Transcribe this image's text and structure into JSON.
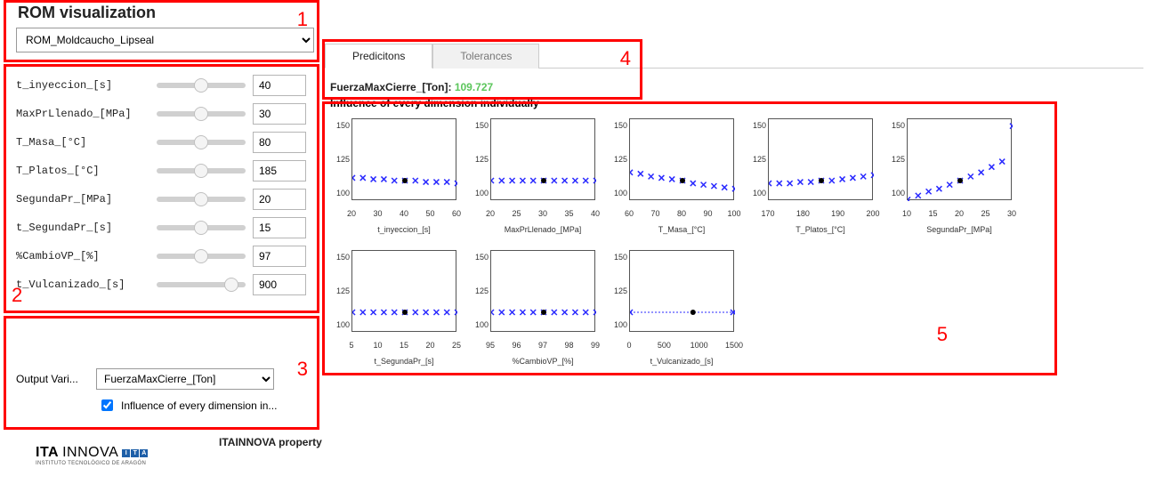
{
  "header": {
    "title": "ROM visualization",
    "rom_selected": "ROM_Moldcaucho_Lipseal"
  },
  "sliders": [
    {
      "label": "t_inyeccion_[s]",
      "value": "40",
      "thumb_pct": 50
    },
    {
      "label": "MaxPrLlenado_[MPa]",
      "value": "30",
      "thumb_pct": 50
    },
    {
      "label": "T_Masa_[°C]",
      "value": "80",
      "thumb_pct": 50
    },
    {
      "label": "T_Platos_[°C]",
      "value": "185",
      "thumb_pct": 50
    },
    {
      "label": "SegundaPr_[MPa]",
      "value": "20",
      "thumb_pct": 50
    },
    {
      "label": "t_SegundaPr_[s]",
      "value": "15",
      "thumb_pct": 50
    },
    {
      "label": "%CambioVP_[%]",
      "value": "97",
      "thumb_pct": 50
    },
    {
      "label": "t_Vulcanizado_[s]",
      "value": "900",
      "thumb_pct": 84
    }
  ],
  "output": {
    "label": "Output Vari...",
    "selected": "FuerzaMaxCierre_[Ton]",
    "checkbox_label": "Influence of every dimension in...",
    "checkbox_checked": true
  },
  "tabs": {
    "active": "Predicitons",
    "inactive": "Tolerances"
  },
  "prediction": {
    "name": "FuerzaMaxCierre_[Ton]:",
    "value": "109.727"
  },
  "charts_title": "Influence of every dimension individually",
  "yticks": [
    "150",
    "125",
    "100"
  ],
  "annotations": {
    "n1": "1",
    "n2": "2",
    "n3": "3",
    "n4": "4",
    "n5": "5"
  },
  "footer": {
    "property": "ITAINNOVA property",
    "brand_bold": "ITA",
    "brand_light": "INNOVA",
    "brand_sub": "INSTITUTO TECNOLÓGICO DE ARAGÓN"
  },
  "chart_data": [
    {
      "type": "scatter",
      "xlabel": "t_inyeccion_[s]",
      "ylabel": "",
      "ylim": [
        95,
        155
      ],
      "x_ticks": [
        20,
        30,
        40,
        50,
        60
      ],
      "marker_x": 40,
      "x": [
        20,
        24,
        28,
        32,
        36,
        40,
        44,
        48,
        52,
        56,
        60
      ],
      "y": [
        112,
        112,
        111,
        111,
        110,
        110,
        110,
        109,
        109,
        109,
        108
      ]
    },
    {
      "type": "scatter",
      "xlabel": "MaxPrLlenado_[MPa]",
      "ylabel": "",
      "ylim": [
        95,
        155
      ],
      "x_ticks": [
        20,
        25,
        30,
        35,
        40
      ],
      "marker_x": 30,
      "x": [
        20,
        22,
        24,
        26,
        28,
        30,
        32,
        34,
        36,
        38,
        40
      ],
      "y": [
        110,
        110,
        110,
        110,
        110,
        110,
        110,
        110,
        110,
        110,
        110
      ]
    },
    {
      "type": "scatter",
      "xlabel": "T_Masa_[°C]",
      "ylabel": "",
      "ylim": [
        95,
        155
      ],
      "x_ticks": [
        60,
        70,
        80,
        90,
        100
      ],
      "marker_x": 80,
      "x": [
        60,
        64,
        68,
        72,
        76,
        80,
        84,
        88,
        92,
        96,
        100
      ],
      "y": [
        116,
        115,
        113,
        112,
        111,
        110,
        108,
        107,
        106,
        105,
        104
      ]
    },
    {
      "type": "scatter",
      "xlabel": "T_Platos_[°C]",
      "ylabel": "",
      "ylim": [
        95,
        155
      ],
      "x_ticks": [
        170,
        180,
        190,
        200
      ],
      "marker_x": 185,
      "x": [
        170,
        173,
        176,
        179,
        182,
        185,
        188,
        191,
        194,
        197,
        200
      ],
      "y": [
        108,
        108,
        108,
        109,
        109,
        110,
        110,
        111,
        112,
        113,
        114
      ]
    },
    {
      "type": "scatter",
      "xlabel": "SegundaPr_[MPa]",
      "ylabel": "",
      "ylim": [
        95,
        155
      ],
      "x_ticks": [
        10,
        15,
        20,
        25,
        30
      ],
      "marker_x": 20,
      "x": [
        10,
        12,
        14,
        16,
        18,
        20,
        22,
        24,
        26,
        28,
        30
      ],
      "y": [
        96,
        99,
        102,
        104,
        107,
        110,
        113,
        116,
        120,
        124,
        150
      ]
    },
    {
      "type": "scatter",
      "xlabel": "t_SegundaPr_[s]",
      "ylabel": "",
      "ylim": [
        95,
        155
      ],
      "x_ticks": [
        5,
        10,
        15,
        20,
        25
      ],
      "marker_x": 15,
      "x": [
        5,
        7,
        9,
        11,
        13,
        15,
        17,
        19,
        21,
        23,
        25
      ],
      "y": [
        110,
        110,
        110,
        110,
        110,
        110,
        110,
        110,
        110,
        110,
        110
      ]
    },
    {
      "type": "scatter",
      "xlabel": "%CambioVP_[%]",
      "ylabel": "",
      "ylim": [
        95,
        155
      ],
      "x_ticks": [
        95,
        96,
        97,
        98,
        99
      ],
      "marker_x": 97,
      "x": [
        95,
        95.4,
        95.8,
        96.2,
        96.6,
        97,
        97.4,
        97.8,
        98.2,
        98.6,
        99
      ],
      "y": [
        110,
        110,
        110,
        110,
        110,
        110,
        110,
        110,
        110,
        110,
        110
      ]
    },
    {
      "type": "scatter",
      "xlabel": "t_Vulcanizado_[s]",
      "ylabel": "",
      "ylim": [
        95,
        155
      ],
      "x_ticks": [
        0,
        500,
        1000,
        1500
      ],
      "marker_x": 900,
      "dashed": true,
      "x": [
        0,
        1800
      ],
      "y": [
        110,
        110
      ]
    }
  ]
}
